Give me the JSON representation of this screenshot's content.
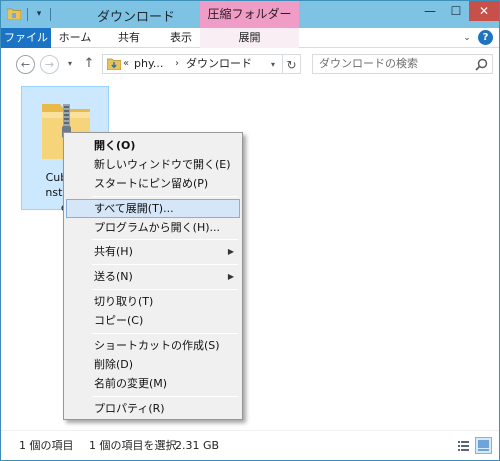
{
  "titlebar": {
    "title": "ダウンロード",
    "contextual_tab": "圧縮フォルダー ツール",
    "qa_dropdown": "▾",
    "minimize": "—",
    "maximize": "☐",
    "close": "✕"
  },
  "ribbon": {
    "tabs": [
      "ファイル",
      "ホーム",
      "共有",
      "表示",
      "展開"
    ],
    "collapse_caret": "⌄",
    "help": "?"
  },
  "nav": {
    "back": "←",
    "forward": "→",
    "recent": "▾",
    "up": "↑",
    "address_prefix": "«",
    "address_parent": "phy...",
    "address_sep": "›",
    "address_current": "ダウンロード",
    "address_dropdown": "▾",
    "refresh": "↻",
    "search_placeholder": "ダウンロードの検索"
  },
  "file": {
    "label_lines": [
      "Cubase",
      "nstaller",
      "e."
    ]
  },
  "context_menu": {
    "items": [
      {
        "label": "開く(O)"
      },
      {
        "label": "新しいウィンドウで開く(E)"
      },
      {
        "label": "スタートにピン留め(P)"
      },
      {
        "label": "すべて展開(T)..."
      },
      {
        "label": "プログラムから開く(H)..."
      },
      {
        "label": "共有(H)",
        "arrow": "▶"
      },
      {
        "label": "送る(N)",
        "arrow": "▶"
      },
      {
        "label": "切り取り(T)"
      },
      {
        "label": "コピー(C)"
      },
      {
        "label": "ショートカットの作成(S)"
      },
      {
        "label": "削除(D)"
      },
      {
        "label": "名前の変更(M)"
      },
      {
        "label": "プロパティ(R)"
      }
    ]
  },
  "status": {
    "item_count": "1 個の項目",
    "selected": "1 個の項目を選択",
    "size": "2.31 GB"
  },
  "colors": {
    "titlebar": "#7ec3e3",
    "file_tab": "#1a73c4",
    "contextual_tab": "#ef9cc6",
    "selection": "#cce8ff",
    "menu_highlight": "#d5e6f8",
    "close_button": "#c7504a"
  }
}
